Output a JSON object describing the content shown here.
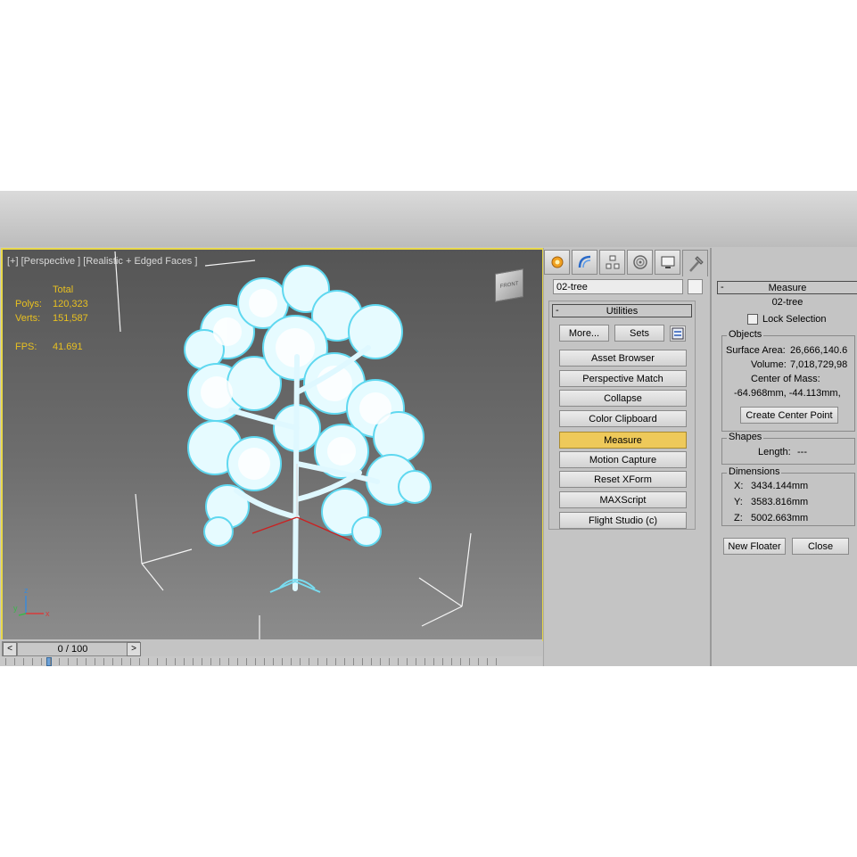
{
  "viewport": {
    "label": "[+] [Perspective ] [Realistic + Edged Faces ]",
    "stats": {
      "header": "Total",
      "polys_label": "Polys:",
      "polys": "120,323",
      "verts_label": "Verts:",
      "verts": "151,587",
      "fps_label": "FPS:",
      "fps": "41.691"
    },
    "navcube_label": "FRONT",
    "axis": {
      "x": "x",
      "y": "y",
      "z": "z"
    }
  },
  "timeline": {
    "frame": "0 / 100",
    "prev": "<",
    "next": ">"
  },
  "command_panel": {
    "tabs": [
      {
        "icon": "create-icon"
      },
      {
        "icon": "modify-icon"
      },
      {
        "icon": "hierarchy-icon"
      },
      {
        "icon": "motion-icon"
      },
      {
        "icon": "display-icon"
      },
      {
        "icon": "utilities-hammer-icon"
      }
    ],
    "object_name": "02-tree",
    "utilities": {
      "title": "Utilities",
      "collapse": "-",
      "more": "More...",
      "sets": "Sets",
      "buttons": [
        "Asset Browser",
        "Perspective Match",
        "Collapse",
        "Color Clipboard",
        "Measure",
        "Motion Capture",
        "Reset XForm",
        "MAXScript",
        "Flight Studio (c)"
      ],
      "active_button": "Measure"
    }
  },
  "measure": {
    "title": "Measure",
    "collapse": "-",
    "object_name": "02-tree",
    "lock_selection": "Lock Selection",
    "objects_group": "Objects",
    "surface_area_label": "Surface Area:",
    "surface_area": "26,666,140.6",
    "volume_label": "Volume:",
    "volume": "7,018,729,98",
    "center_of_mass_label": "Center of Mass:",
    "center_of_mass": "-64.968mm, -44.113mm,",
    "create_center_point": "Create Center Point",
    "shapes_group": "Shapes",
    "length_label": "Length:",
    "length": "---",
    "dimensions_group": "Dimensions",
    "x_label": "X:",
    "x": "3434.144mm",
    "y_label": "Y:",
    "y": "3583.816mm",
    "z_label": "Z:",
    "z": "5002.663mm",
    "new_floater": "New Floater",
    "close": "Close"
  }
}
